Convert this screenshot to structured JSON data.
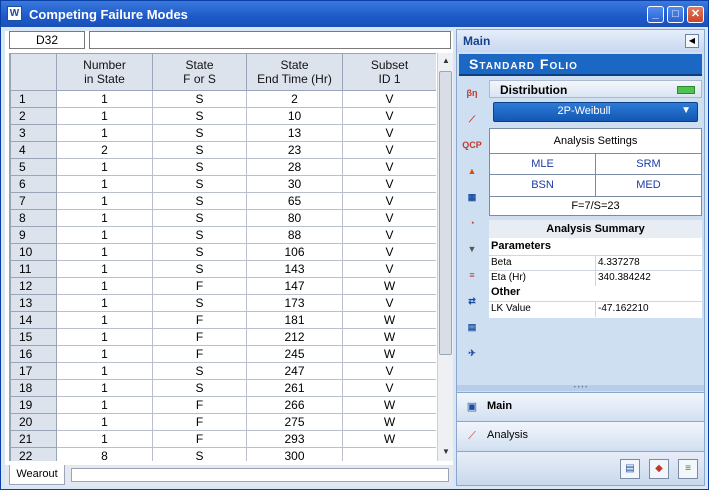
{
  "window": {
    "title": "Competing Failure Modes"
  },
  "sheet": {
    "cell_ref": "D32",
    "formula": "",
    "columns": [
      "",
      "Number\nin State",
      "State\nF or S",
      "State\nEnd Time (Hr)",
      "Subset\nID 1"
    ],
    "rows": [
      [
        "1",
        "1",
        "S",
        "2",
        "V"
      ],
      [
        "2",
        "1",
        "S",
        "10",
        "V"
      ],
      [
        "3",
        "1",
        "S",
        "13",
        "V"
      ],
      [
        "4",
        "2",
        "S",
        "23",
        "V"
      ],
      [
        "5",
        "1",
        "S",
        "28",
        "V"
      ],
      [
        "6",
        "1",
        "S",
        "30",
        "V"
      ],
      [
        "7",
        "1",
        "S",
        "65",
        "V"
      ],
      [
        "8",
        "1",
        "S",
        "80",
        "V"
      ],
      [
        "9",
        "1",
        "S",
        "88",
        "V"
      ],
      [
        "10",
        "1",
        "S",
        "106",
        "V"
      ],
      [
        "11",
        "1",
        "S",
        "143",
        "V"
      ],
      [
        "12",
        "1",
        "F",
        "147",
        "W"
      ],
      [
        "13",
        "1",
        "S",
        "173",
        "V"
      ],
      [
        "14",
        "1",
        "F",
        "181",
        "W"
      ],
      [
        "15",
        "1",
        "F",
        "212",
        "W"
      ],
      [
        "16",
        "1",
        "F",
        "245",
        "W"
      ],
      [
        "17",
        "1",
        "S",
        "247",
        "V"
      ],
      [
        "18",
        "1",
        "S",
        "261",
        "V"
      ],
      [
        "19",
        "1",
        "F",
        "266",
        "W"
      ],
      [
        "20",
        "1",
        "F",
        "275",
        "W"
      ],
      [
        "21",
        "1",
        "F",
        "293",
        "W"
      ],
      [
        "22",
        "8",
        "S",
        "300",
        ""
      ]
    ],
    "tab": "Wearout"
  },
  "panel": {
    "header": "Main",
    "folio": "Standard Folio",
    "distribution_label": "Distribution",
    "distribution_value": "2P-Weibull",
    "analysis_settings": "Analysis Settings",
    "settings": {
      "mle": "MLE",
      "srm": "SRM",
      "bsn": "BSN",
      "med": "MED",
      "footer": "F=7/S=23"
    },
    "summary": {
      "title": "Analysis Summary",
      "parameters_label": "Parameters",
      "beta_label": "Beta",
      "beta_value": "4.337278",
      "eta_label": "Eta (Hr)",
      "eta_value": "340.384242",
      "other_label": "Other",
      "lk_label": "LK Value",
      "lk_value": "-47.162210"
    },
    "nav": {
      "main": "Main",
      "analysis": "Analysis"
    }
  }
}
